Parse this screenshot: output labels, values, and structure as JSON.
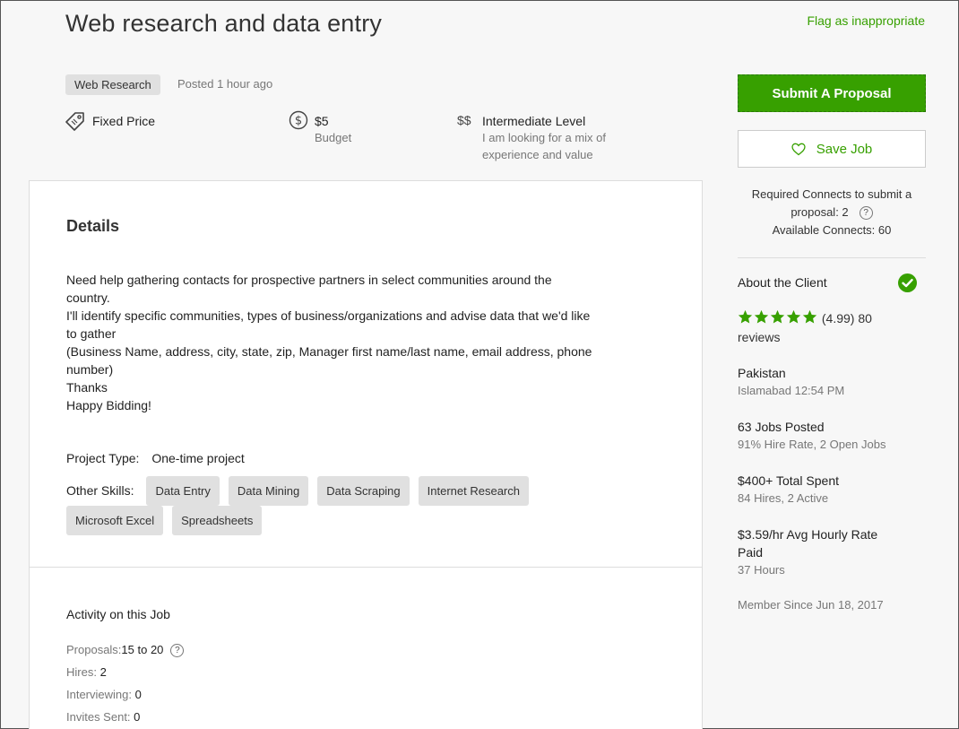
{
  "job": {
    "title": "Web research and data entry",
    "flag_label": "Flag as inappropriate",
    "category": "Web Research",
    "posted": "Posted 1 hour ago"
  },
  "meta": {
    "price_type": "Fixed Price",
    "budget_value": "$5",
    "budget_label": "Budget",
    "level_icon": "$$",
    "level": "Intermediate Level",
    "level_desc_1": "I am looking for a mix of",
    "level_desc_2": "experience and value"
  },
  "details": {
    "heading": "Details",
    "lines": [
      "Need help gathering contacts for prospective partners in select communities around the",
      "country.",
      "I'll identify specific communities, types of business/organizations and advise data that we'd like",
      "to gather",
      "(Business Name, address, city, state, zip, Manager first name/last name, email address, phone",
      "number)",
      "Thanks",
      "Happy Bidding!"
    ],
    "project_type_label": "Project Type:",
    "project_type": "One-time project",
    "other_skills_label": "Other Skills:",
    "skills": [
      "Data Entry",
      "Data Mining",
      "Data Scraping",
      "Internet Research",
      "Microsoft Excel",
      "Spreadsheets"
    ]
  },
  "activity": {
    "heading": "Activity on this Job",
    "proposals_label": "Proposals:",
    "proposals_value": "15 to 20",
    "hires_label": "Hires:",
    "hires_value": "2",
    "interviewing_label": "Interviewing:",
    "interviewing_value": "0",
    "invites_label": "Invites Sent:",
    "invites_value": "0"
  },
  "sidebar": {
    "submit_label": "Submit A Proposal",
    "save_label": "Save Job",
    "connects_line1": "Required Connects to submit a",
    "connects_line2": "proposal: 2",
    "connects_line3": "Available Connects: 60",
    "about_label": "About the Client",
    "rating": 4.99,
    "rating_text": "(4.99) 80",
    "reviews_text": "reviews",
    "country": "Pakistan",
    "city_time": "Islamabad 12:54 PM",
    "jobs_posted": "63 Jobs Posted",
    "hire_rate": "91% Hire Rate, 2 Open Jobs",
    "total_spent": "$400+ Total Spent",
    "hires_active": "84 Hires, 2 Active",
    "rate_value": "$3.59/hr",
    "rate_label": "Avg Hourly Rate",
    "rate_paid": "Paid",
    "hours": "37 Hours",
    "member_since": "Member Since Jun 18, 2017"
  },
  "colors": {
    "accent": "#37a000",
    "tag_bg": "#e0e0e0",
    "page_bg": "#f7f7f7"
  },
  "icons": {
    "price": "tag-icon",
    "budget": "dollar-circle-icon",
    "save": "heart-icon",
    "help": "question-icon",
    "verified": "check-circle-icon",
    "star": "star-icon"
  }
}
